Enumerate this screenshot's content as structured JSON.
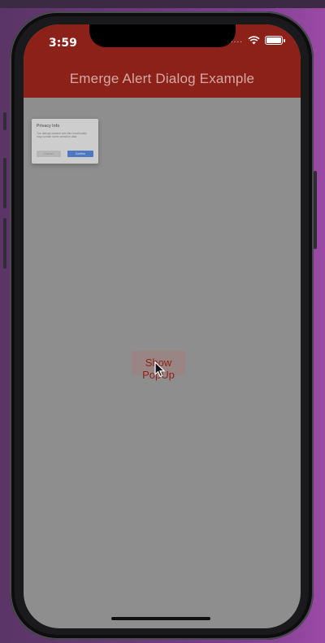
{
  "status_bar": {
    "time": "3:59",
    "signal_dots": "....",
    "wifi_icon": "wifi-icon",
    "battery_icon": "battery-icon"
  },
  "app_bar": {
    "title": "Emerge Alert Dialog Example",
    "background": "#8b2119"
  },
  "dialog": {
    "title": "Privacy Info",
    "body": "The dialogs created with this functionality may contain some sensitive data.",
    "cancel_label": "Cancel",
    "confirm_label": "Confirm",
    "confirm_color": "#4f77c2"
  },
  "main": {
    "show_popup_label": "Show PopUp",
    "overlay_color": "#8e8e8e"
  },
  "cursor_icon": "mouse-pointer-icon"
}
